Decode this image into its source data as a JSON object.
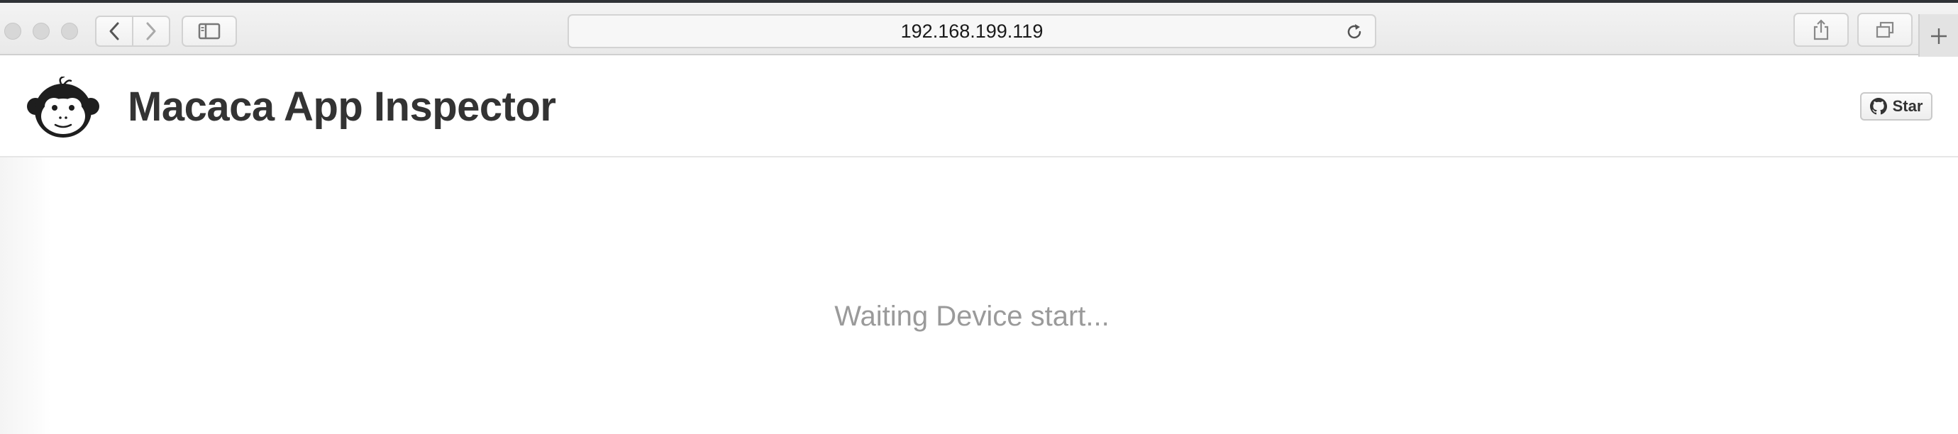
{
  "browser": {
    "address_text": "192.168.199.119",
    "icons": {
      "back": "chevron-left-icon",
      "forward": "chevron-right-icon",
      "sidebar": "sidebar-icon",
      "reload": "reload-icon",
      "share": "share-icon",
      "tabs": "tabs-overview-icon",
      "new_tab": "plus-icon"
    }
  },
  "app": {
    "title": "Macaca App Inspector",
    "logo_icon": "monkey-logo-icon",
    "star_label": "Star",
    "star_icon": "github-icon"
  },
  "main": {
    "status_text": "Waiting Device start..."
  },
  "colors": {
    "title_text": "#333333",
    "status_text": "#9a9a9a",
    "toolbar_bg": "#ececec"
  }
}
